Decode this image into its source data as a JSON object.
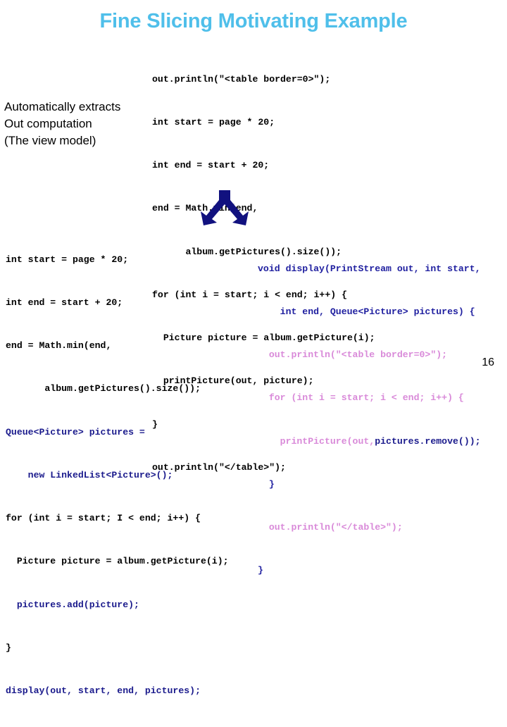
{
  "slide": {
    "title": "Fine Slicing Motivating Example",
    "title_color": "#4fbfea",
    "background": "#ffffff",
    "page_number": "16"
  },
  "annotation": {
    "lines": [
      "Automatically extracts",
      "Out computation",
      "(The view model)"
    ]
  },
  "code_original": {
    "label": "original-program",
    "color": "#000000",
    "lines": [
      "out.println(\"<table border=0>\");",
      "int start = page * 20;",
      "int end = start + 20;",
      "end = Math.min(end,",
      "      album.getPictures().size());",
      "for (int i = start; i < end; i++) {",
      "  Picture picture = album.getPicture(i);",
      "  printPicture(out, picture);",
      "}",
      "out.println(\"</table>\");"
    ]
  },
  "code_in": {
    "label": "in-slice-program",
    "lines": [
      {
        "text": "int start = page * 20;",
        "color": "#000000"
      },
      {
        "text": "int end = start + 20;",
        "color": "#000000"
      },
      {
        "text": "end = Math.min(end,",
        "color": "#000000"
      },
      {
        "text": "       album.getPictures().size());",
        "color": "#000000"
      },
      {
        "text": "Queue<Picture> pictures =",
        "color": "#1a1a8c"
      },
      {
        "text": "    new LinkedList<Picture>();",
        "color": "#1a1a8c"
      },
      {
        "text": "for (int i = start; I < end; i++) {",
        "color": "#000000"
      },
      {
        "text": "  Picture picture = album.getPicture(i);",
        "color": "#000000"
      },
      {
        "text": "  pictures.add(picture);",
        "color": "#1a1a8c"
      },
      {
        "text": "}",
        "color": "#000000"
      },
      {
        "text": "display(out, start, end, pictures);",
        "color": "#1a1a8c"
      }
    ]
  },
  "code_out": {
    "label": "out-slice-program",
    "lines": [
      {
        "text": "void display(PrintStream out, int start,",
        "color": "#2020a0"
      },
      {
        "text": "    int end, Queue<Picture> pictures) {",
        "color": "#2020a0"
      },
      {
        "text": "  out.println(\"<table border=0>\");",
        "color": "#d98ad9"
      },
      {
        "text": "  for (int i = start; i < end; i++) {",
        "color": "#d98ad9"
      },
      {
        "text": "    printPicture(out,",
        "color": "#d98ad9",
        "tail": "pictures.remove());",
        "tail_color": "#1a1a8c"
      },
      {
        "text": "  }",
        "color": "#2020a0"
      },
      {
        "text": "  out.println(\"</table>\");",
        "color": "#d98ad9"
      },
      {
        "text": "}",
        "color": "#2020a0"
      }
    ]
  },
  "arrow": {
    "name": "split-down-arrow",
    "color": "#11117f",
    "direction": "down-split"
  }
}
